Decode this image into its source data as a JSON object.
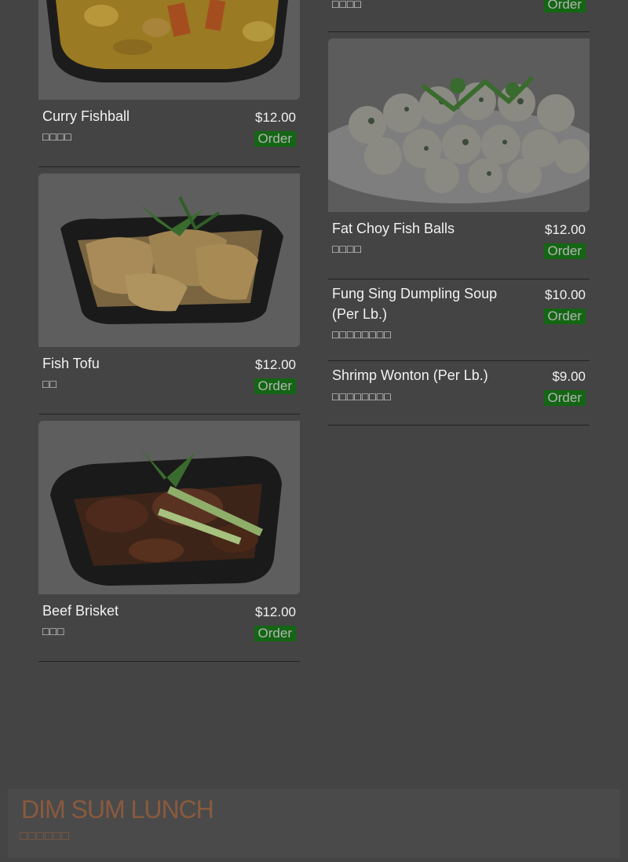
{
  "colors": {
    "background": "#444444",
    "order_bg": "#146614",
    "order_text": "#b4b4b4",
    "banner_text": "#8a5a3e"
  },
  "left_items": [
    {
      "name": "Curry Fishball",
      "cn": "□□□□",
      "price": "$12.00",
      "order": "Order",
      "image": "curry-fishball-photo"
    },
    {
      "name": "Fish Tofu",
      "cn": "□□",
      "price": "$12.00",
      "order": "Order",
      "image": "fish-tofu-photo"
    },
    {
      "name": "Beef Brisket",
      "cn": "□□□",
      "price": "$12.00",
      "order": "Order",
      "image": "beef-brisket-photo"
    }
  ],
  "right_items": [
    {
      "cn": "□□□□",
      "order": "Order"
    },
    {
      "name": "Fat Choy Fish Balls",
      "cn": "□□□□",
      "price": "$12.00",
      "order": "Order",
      "image": "fat-choy-fish-balls-photo"
    },
    {
      "name": "Fung Sing Dumpling Soup (Per Lb.)",
      "cn": "□□□□□□□□",
      "price": "$10.00",
      "order": "Order"
    },
    {
      "name": "Shrimp Wonton (Per Lb.)",
      "cn": "□□□□□□□□",
      "price": "$9.00",
      "order": "Order"
    }
  ],
  "banner": {
    "title": "DIM SUM LUNCH",
    "cn": "□□□□□□"
  }
}
